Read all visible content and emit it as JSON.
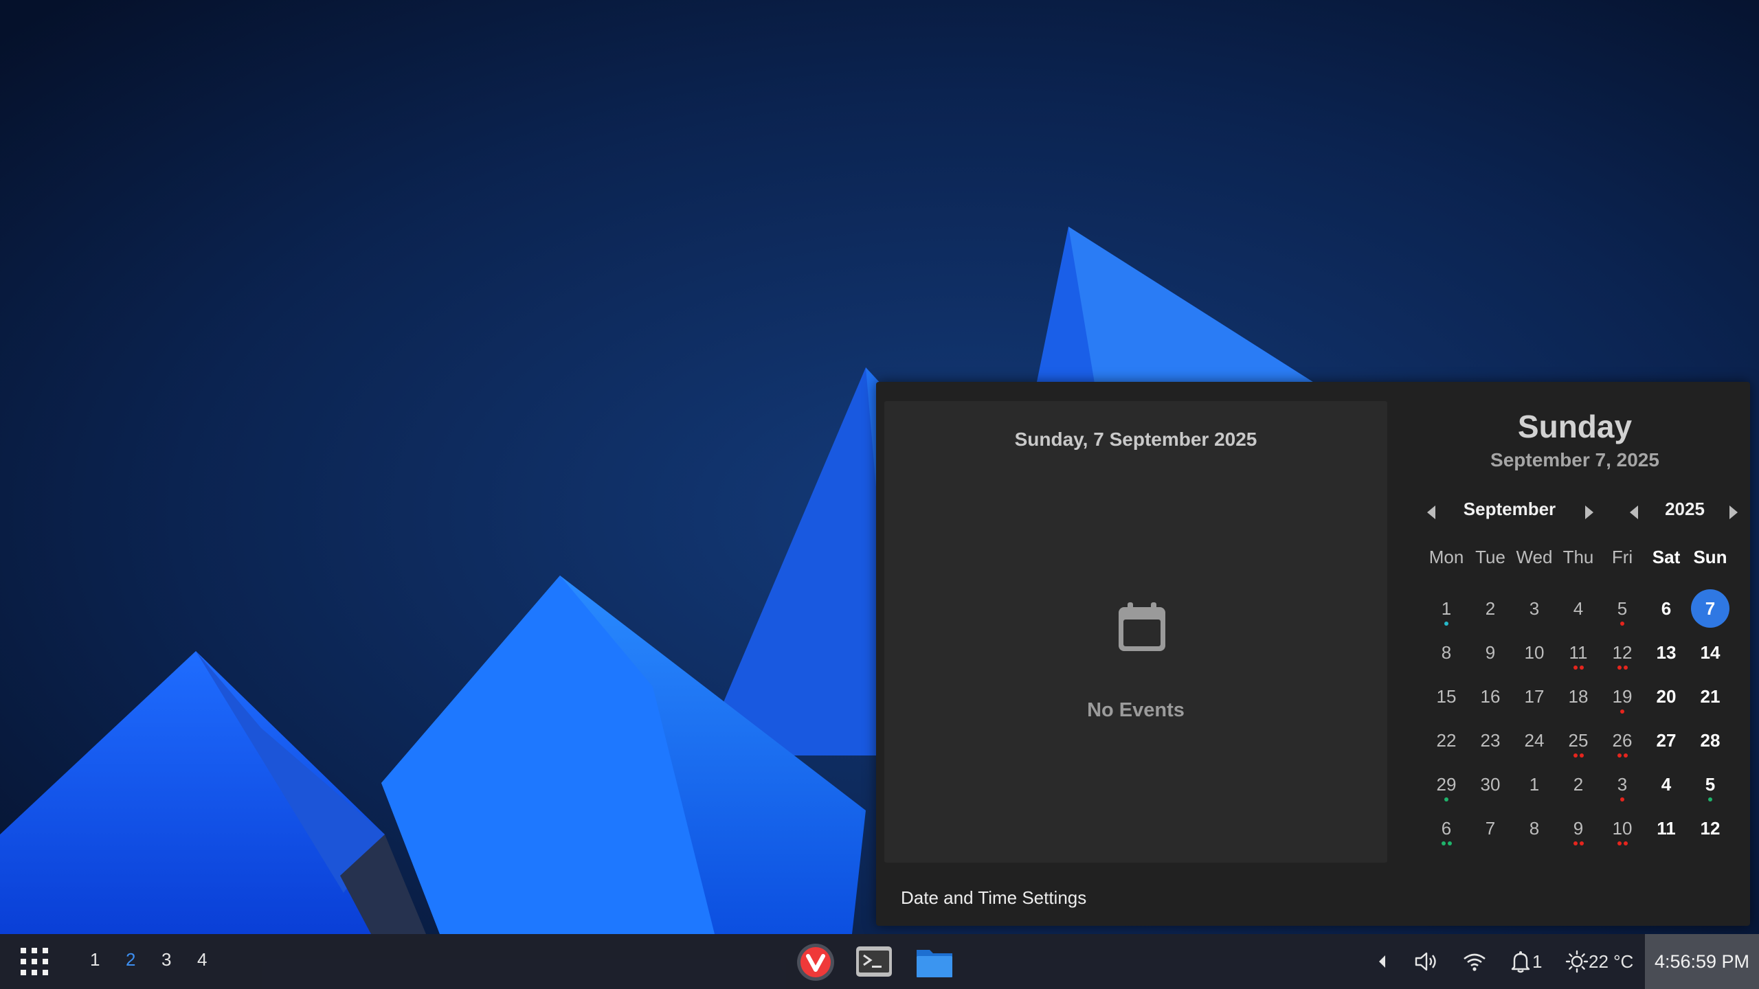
{
  "popup": {
    "events_title": "Sunday, 7 September 2025",
    "no_events": "No Events",
    "settings_link": "Date and Time Settings",
    "day_name": "Sunday",
    "date_full": "September 7, 2025",
    "month": "September",
    "year": "2025",
    "weekdays": [
      "Mon",
      "Tue",
      "Wed",
      "Thu",
      "Fri",
      "Sat",
      "Sun"
    ],
    "today_color": "#2f78e3",
    "dot_colors": {
      "red": "#e5251d",
      "green": "#1fb36b",
      "teal": "#27b8c9"
    },
    "weeks": [
      [
        {
          "d": "1",
          "dots": [
            "teal"
          ]
        },
        {
          "d": "2"
        },
        {
          "d": "3"
        },
        {
          "d": "4"
        },
        {
          "d": "5",
          "dots": [
            "red"
          ]
        },
        {
          "d": "6"
        },
        {
          "d": "7",
          "today": true
        }
      ],
      [
        {
          "d": "8"
        },
        {
          "d": "9"
        },
        {
          "d": "10"
        },
        {
          "d": "11",
          "dots": [
            "red",
            "red"
          ]
        },
        {
          "d": "12",
          "dots": [
            "red",
            "red"
          ]
        },
        {
          "d": "13"
        },
        {
          "d": "14"
        }
      ],
      [
        {
          "d": "15"
        },
        {
          "d": "16"
        },
        {
          "d": "17"
        },
        {
          "d": "18"
        },
        {
          "d": "19",
          "dots": [
            "red"
          ]
        },
        {
          "d": "20"
        },
        {
          "d": "21"
        }
      ],
      [
        {
          "d": "22"
        },
        {
          "d": "23"
        },
        {
          "d": "24"
        },
        {
          "d": "25",
          "dots": [
            "red",
            "red"
          ]
        },
        {
          "d": "26",
          "dots": [
            "red",
            "red"
          ]
        },
        {
          "d": "27"
        },
        {
          "d": "28"
        }
      ],
      [
        {
          "d": "29",
          "dots": [
            "green"
          ]
        },
        {
          "d": "30"
        },
        {
          "d": "1"
        },
        {
          "d": "2"
        },
        {
          "d": "3",
          "dots": [
            "red"
          ]
        },
        {
          "d": "4"
        },
        {
          "d": "5",
          "dots": [
            "green"
          ]
        }
      ],
      [
        {
          "d": "6",
          "dots": [
            "green",
            "green"
          ]
        },
        {
          "d": "7"
        },
        {
          "d": "8"
        },
        {
          "d": "9",
          "dots": [
            "red",
            "red"
          ]
        },
        {
          "d": "10",
          "dots": [
            "red",
            "red"
          ]
        },
        {
          "d": "11"
        },
        {
          "d": "12"
        }
      ]
    ]
  },
  "taskbar": {
    "workspaces": [
      "1",
      "2",
      "3",
      "4"
    ],
    "active_workspace": "2",
    "apps": [
      "vivaldi-icon",
      "terminal-icon",
      "files-icon"
    ],
    "notification_count": "1",
    "weather": "22 °C",
    "clock": "4:56:59 PM",
    "accent": "#3d8ef0"
  }
}
